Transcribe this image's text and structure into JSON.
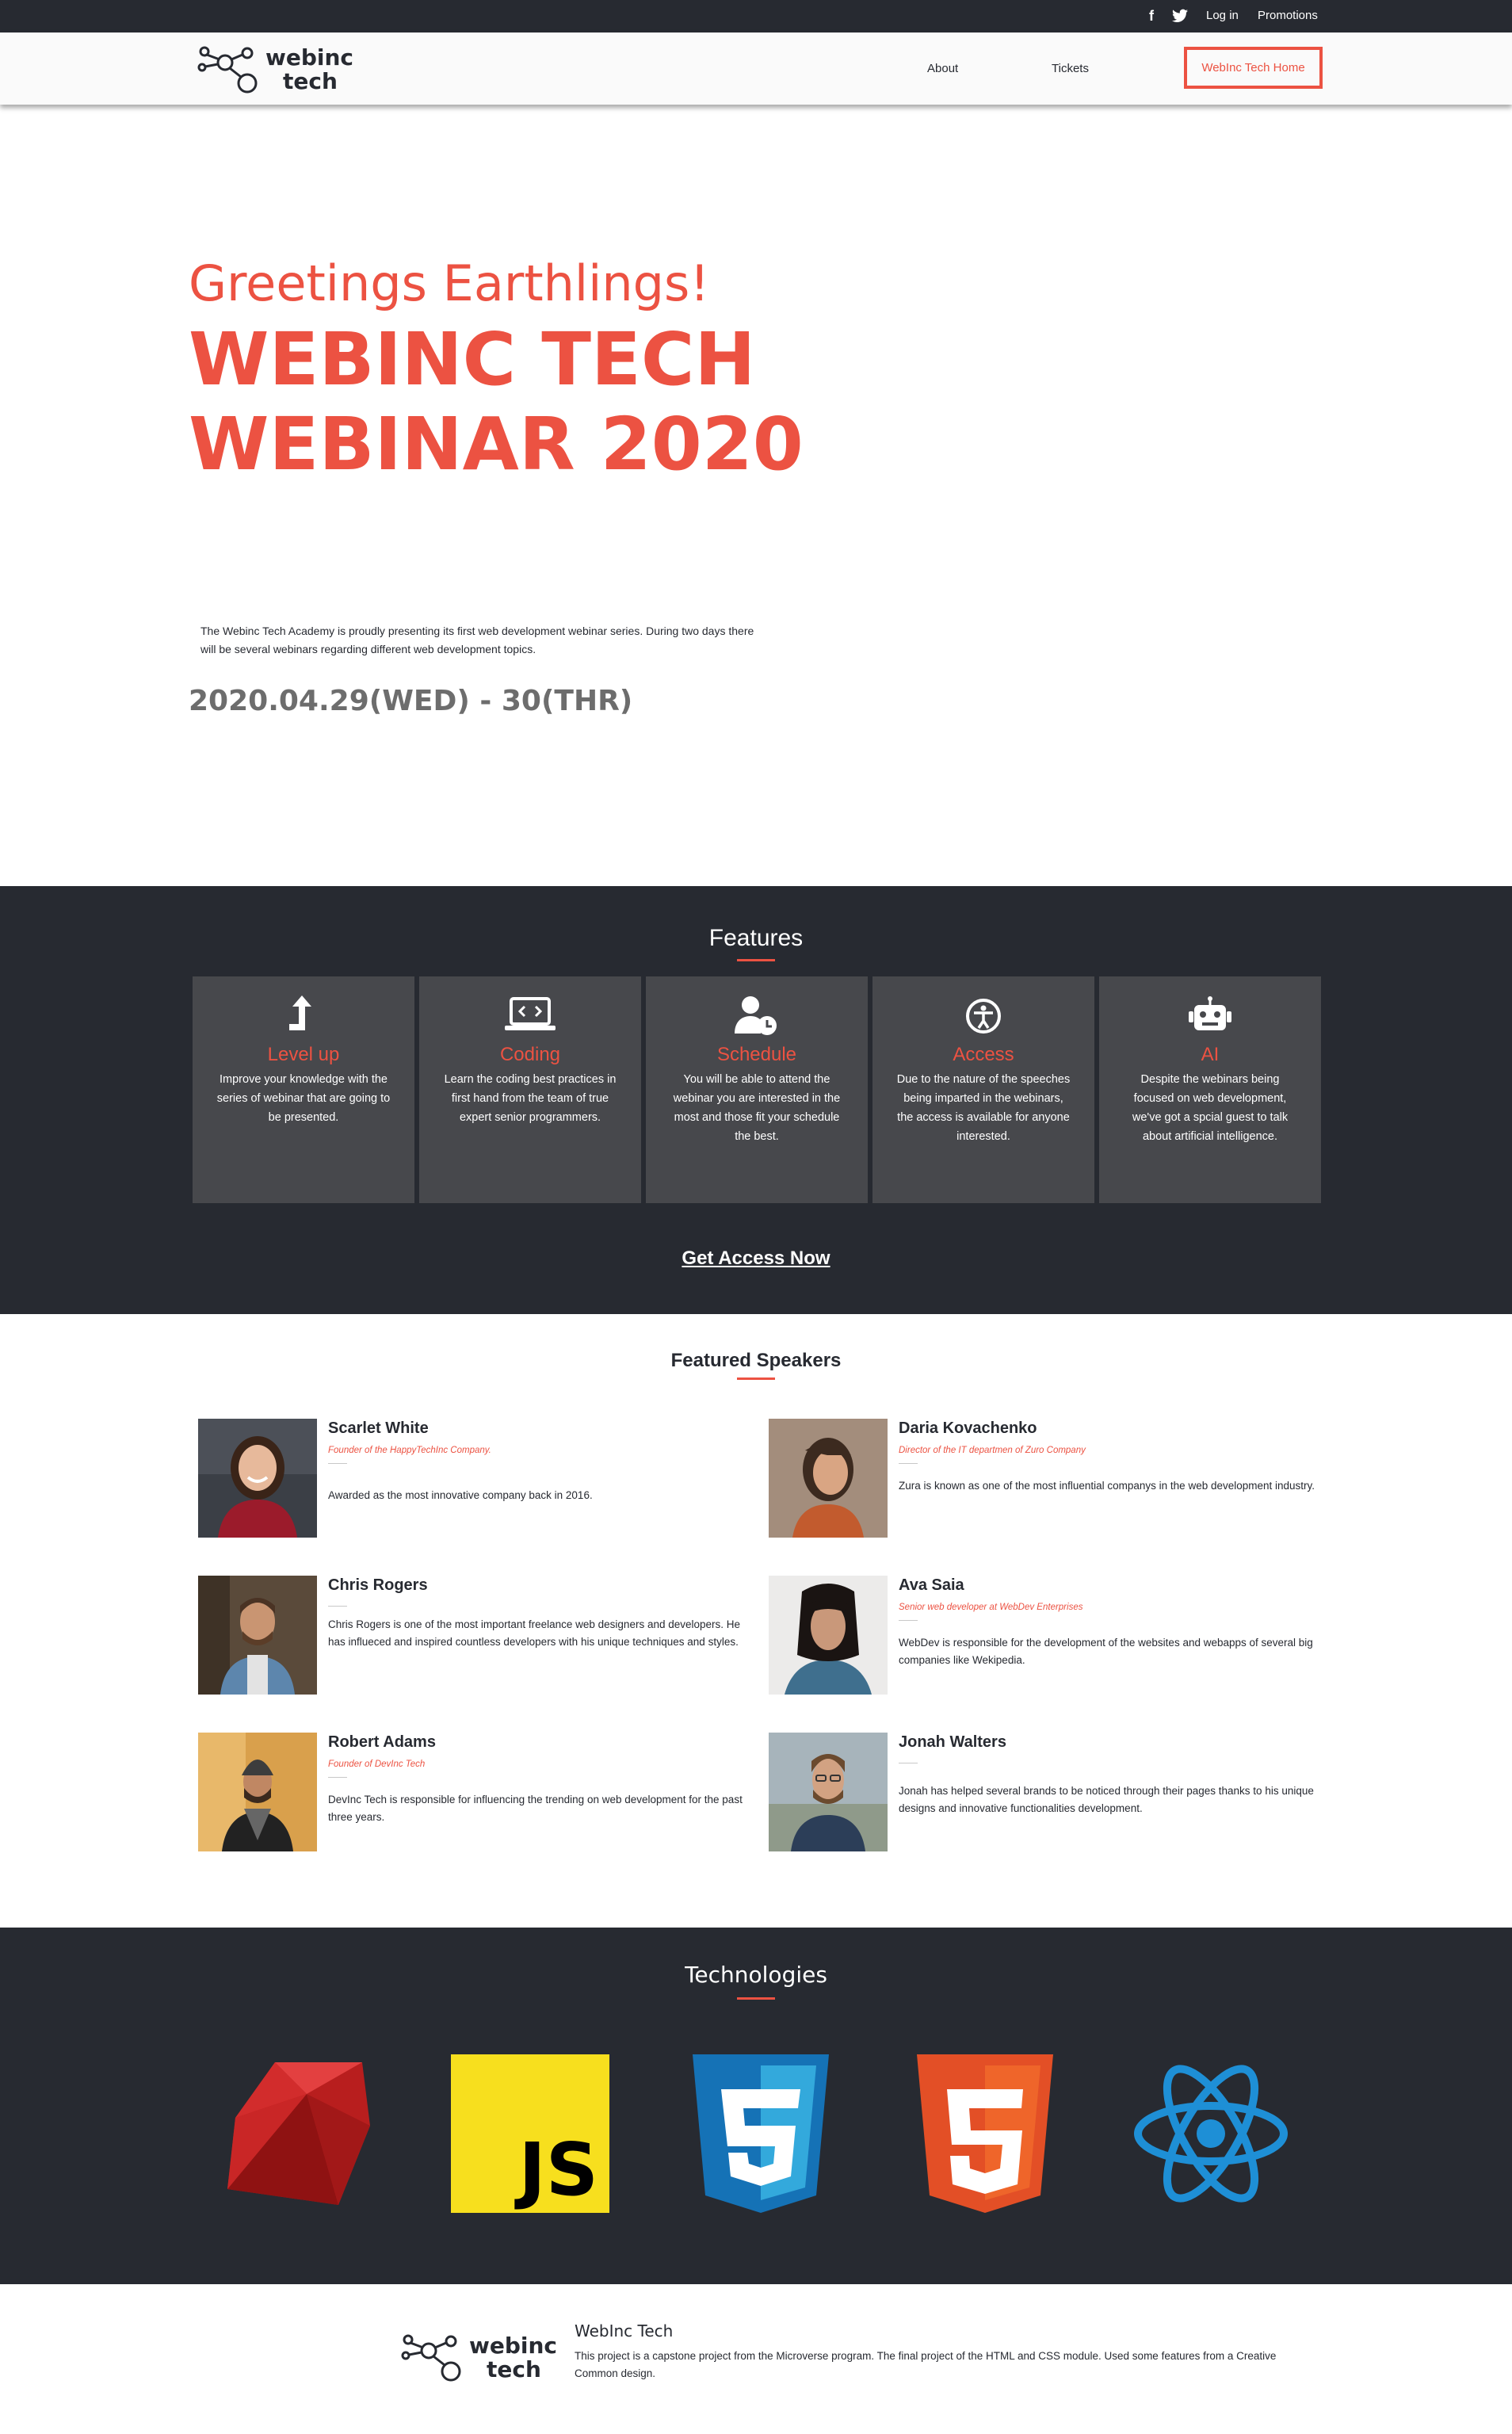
{
  "topbar": {
    "icons": [
      "facebook-icon",
      "twitter-icon"
    ],
    "login_label": "Log in",
    "promotions_label": "Promotions"
  },
  "header": {
    "logo_line1": "webinc",
    "logo_line2": "tech",
    "nav": {
      "about": "About",
      "tickets": "Tickets",
      "home_button": "WebInc Tech Home"
    }
  },
  "hero": {
    "greeting": "Greetings Earthlings!",
    "title": "WEBINC TECH WEBINAR 2020",
    "description": "The Webinc Tech Academy is proudly presenting its first web development webinar series. During two days there will be several webinars regarding different web development topics.",
    "date": "2020.04.29(WED) - 30(THR)"
  },
  "features": {
    "heading": "Features",
    "cards": [
      {
        "icon": "level-up-icon",
        "title": "Level up",
        "text": "Improve your knowledge with the series of webinar that are going to be presented."
      },
      {
        "icon": "laptop-code-icon",
        "title": "Coding",
        "text": "Learn the coding best practices in first hand from the team of true expert senior programmers."
      },
      {
        "icon": "user-clock-icon",
        "title": "Schedule",
        "text": "You will be able to attend the webinar you are interested in the most and those fit your schedule the best."
      },
      {
        "icon": "accessibility-icon",
        "title": "Access",
        "text": "Due to the nature of the speeches being imparted in the webinars, the access is available for anyone interested."
      },
      {
        "icon": "robot-icon",
        "title": "AI",
        "text": "Despite the webinars being focused on web development, we've got a spcial guest to talk about artificial intelligence."
      }
    ],
    "cta": "Get Access Now"
  },
  "speakers": {
    "heading": "Featured Speakers",
    "items": [
      {
        "name": "Scarlet White",
        "role": "Founder of the HappyTechInc Company.",
        "bio": "Awarded as the most innovative company back in 2016."
      },
      {
        "name": "Daria Kovachenko",
        "role": "Director of the IT departmen of Zuro Company",
        "bio": "Zura is known as one of the most influential companys in the web development industry."
      },
      {
        "name": "Chris Rogers",
        "role": "",
        "bio": "Chris Rogers is one of the most important freelance web designers and developers. He has influeced and inspired countless developers with his unique techniques and styles."
      },
      {
        "name": "Ava Saia",
        "role": "Senior web developer at WebDev Enterprises",
        "bio": "WebDev is responsible for the development of the websites and webapps of several big companies like Wekipedia."
      },
      {
        "name": "Robert Adams",
        "role": "Founder of DevInc Tech",
        "bio": "DevInc Tech is responsible for influencing the trending on web development for the past three years."
      },
      {
        "name": "Jonah Walters",
        "role": "",
        "bio": "Jonah has helped several brands to be noticed through their pages thanks to his unique designs and innovative functionalities development."
      }
    ]
  },
  "technologies": {
    "heading": "Technologies",
    "logos": [
      "ruby-logo",
      "javascript-logo",
      "css3-logo",
      "html5-logo",
      "react-logo"
    ],
    "js_text": "JS"
  },
  "footer": {
    "logo_line1": "webinc",
    "logo_line2": "tech",
    "title": "WebInc Tech",
    "text": "This project is a capstone project from the Microverse program. The final project of the HTML and CSS module. Used some features from a Creative Common design."
  },
  "colors": {
    "accent": "#ec5242",
    "dark": "#272a31",
    "card": "#47484c"
  }
}
